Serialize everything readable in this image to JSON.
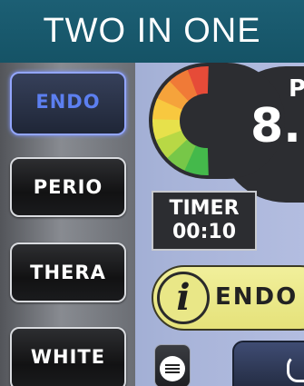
{
  "header": {
    "title": "TWO IN ONE"
  },
  "modes": [
    {
      "label": "ENDO",
      "active": true
    },
    {
      "label": "PERIO",
      "active": false
    },
    {
      "label": "THERA",
      "active": false
    },
    {
      "label": "WHITE",
      "active": false
    }
  ],
  "gauge": {
    "label": "P",
    "value": "8.",
    "level_colors": [
      "#e64b38",
      "#f07a37",
      "#f5a33b",
      "#f8c83f",
      "#e7e14b",
      "#b8d845",
      "#77c748",
      "#44b94b"
    ]
  },
  "timer": {
    "label": "TIMER",
    "value": "00:10"
  },
  "info": {
    "icon": "info-icon",
    "text": "ENDO"
  },
  "controls": {
    "menu_icon": "menu-icon",
    "power_icon": "power-icon"
  },
  "colors": {
    "header_bg": "#1c5f74",
    "active_text": "#5c7ff0",
    "info_bg": "#e9e787"
  }
}
